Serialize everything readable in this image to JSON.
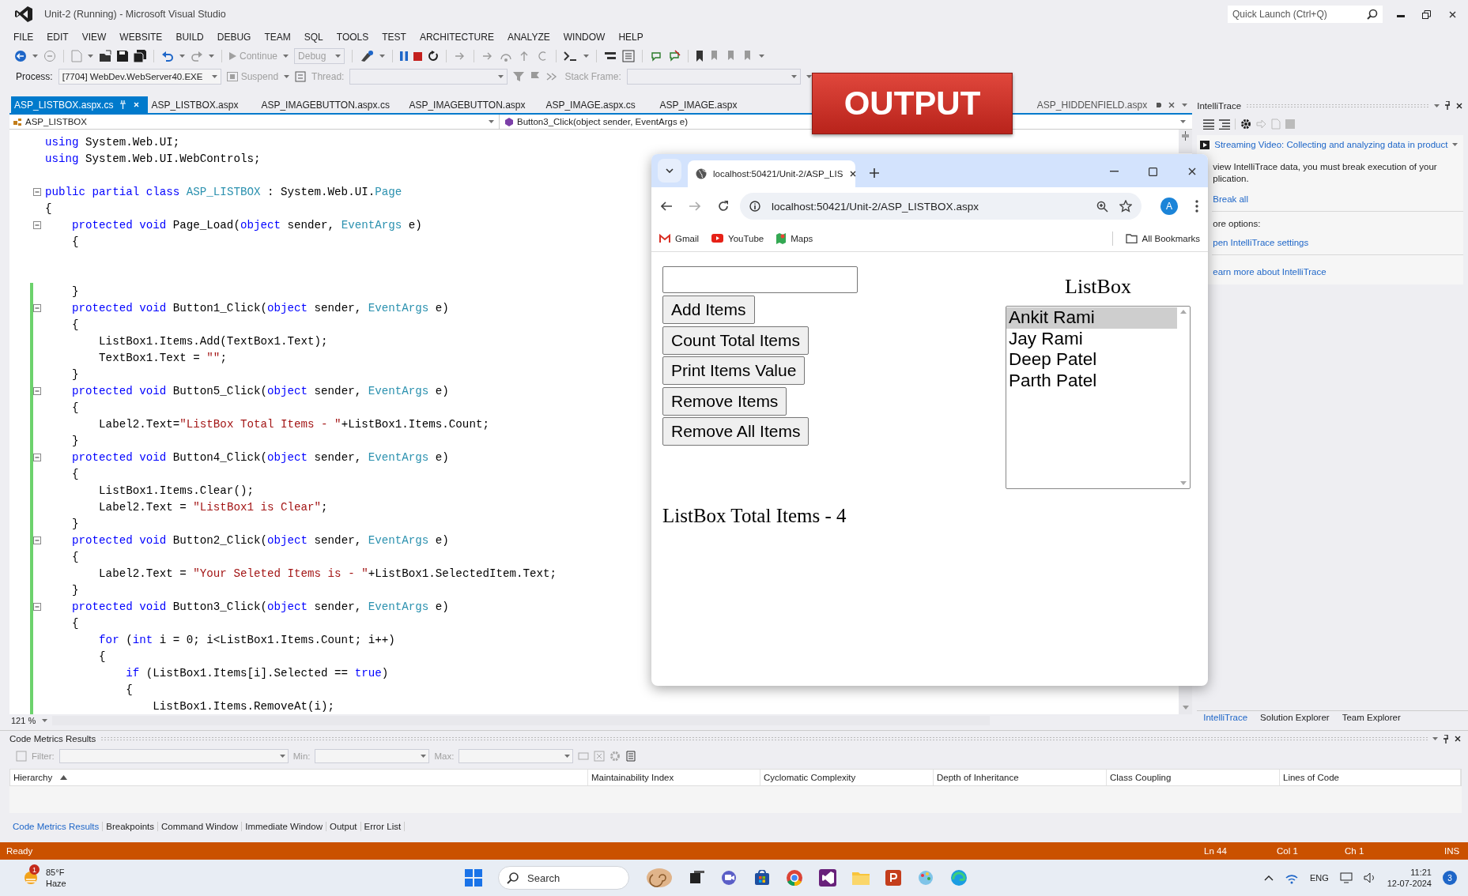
{
  "window": {
    "title": "Unit-2 (Running) - Microsoft Visual Studio",
    "quick_launch": {
      "placeholder": "Quick Launch (Ctrl+Q)"
    }
  },
  "menu": [
    "FILE",
    "EDIT",
    "VIEW",
    "WEBSITE",
    "BUILD",
    "DEBUG",
    "TEAM",
    "SQL",
    "TOOLS",
    "TEST",
    "ARCHITECTURE",
    "ANALYZE",
    "WINDOW",
    "HELP"
  ],
  "toolbar": {
    "continue": "Continue",
    "configuration": "Debug"
  },
  "debug_location": {
    "process_label": "Process:",
    "process": "[7704] WebDev.WebServer40.EXE",
    "suspend": "Suspend",
    "thread_label": "Thread:",
    "stack_frame_label": "Stack Frame:"
  },
  "doc_tabs": [
    {
      "label": "ASP_LISTBOX.aspx.cs",
      "selected": true
    },
    {
      "label": "ASP_LISTBOX.aspx",
      "selected": false
    },
    {
      "label": "ASP_IMAGEBUTTON.aspx.cs",
      "selected": false
    },
    {
      "label": "ASP_IMAGEBUTTON.aspx",
      "selected": false
    },
    {
      "label": "ASP_IMAGE.aspx.cs",
      "selected": false
    },
    {
      "label": "ASP_IMAGE.aspx",
      "selected": false
    }
  ],
  "overflow_tab": {
    "label": "ASP_HIDDENFIELD.aspx"
  },
  "nav_bar": {
    "type": "ASP_LISTBOX",
    "member": "Button3_Click(object sender, EventArgs e)"
  },
  "editor": {
    "zoom": "121 %",
    "lines": [
      {
        "kind": "code",
        "segs": [
          {
            "kind": "keyword",
            "text": "using"
          },
          {
            "kind": "plain",
            "text": " System.Web.UI;"
          }
        ]
      },
      {
        "kind": "code",
        "segs": [
          {
            "kind": "keyword",
            "text": "using"
          },
          {
            "kind": "plain",
            "text": " System.Web.UI.WebControls;"
          }
        ]
      },
      {
        "kind": "blank"
      },
      {
        "kind": "code",
        "fold": true,
        "segs": [
          {
            "kind": "keyword",
            "text": "public partial class "
          },
          {
            "kind": "type",
            "text": "ASP_LISTBOX"
          },
          {
            "kind": "plain",
            "text": " : System.Web.UI."
          },
          {
            "kind": "type",
            "text": "Page"
          }
        ]
      },
      {
        "kind": "code",
        "segs": [
          {
            "kind": "plain",
            "text": "{"
          }
        ]
      },
      {
        "kind": "code",
        "fold": true,
        "segs": [
          {
            "kind": "keyword",
            "text": "    protected void"
          },
          {
            "kind": "plain",
            "text": " Page_Load("
          },
          {
            "kind": "keyword",
            "text": "object"
          },
          {
            "kind": "plain",
            "text": " sender, "
          },
          {
            "kind": "type",
            "text": "EventArgs"
          },
          {
            "kind": "plain",
            "text": " e)"
          }
        ]
      },
      {
        "kind": "code",
        "segs": [
          {
            "kind": "plain",
            "text": "    {"
          }
        ]
      },
      {
        "kind": "blank"
      },
      {
        "kind": "blank"
      },
      {
        "kind": "code",
        "changed": true,
        "segs": [
          {
            "kind": "plain",
            "text": "    }"
          }
        ]
      },
      {
        "kind": "code",
        "changed": true,
        "fold": true,
        "segs": [
          {
            "kind": "keyword",
            "text": "    protected void"
          },
          {
            "kind": "plain",
            "text": " Button1_Click("
          },
          {
            "kind": "keyword",
            "text": "object"
          },
          {
            "kind": "plain",
            "text": " sender, "
          },
          {
            "kind": "type",
            "text": "EventArgs"
          },
          {
            "kind": "plain",
            "text": " e)"
          }
        ]
      },
      {
        "kind": "code",
        "changed": true,
        "segs": [
          {
            "kind": "plain",
            "text": "    {"
          }
        ]
      },
      {
        "kind": "code",
        "changed": true,
        "segs": [
          {
            "kind": "plain",
            "text": "        ListBox1.Items.Add(TextBox1.Text);"
          }
        ]
      },
      {
        "kind": "code",
        "changed": true,
        "segs": [
          {
            "kind": "plain",
            "text": "        TextBox1.Text = "
          },
          {
            "kind": "string",
            "text": "\"\""
          },
          {
            "kind": "plain",
            "text": ";"
          }
        ]
      },
      {
        "kind": "code",
        "changed": true,
        "segs": [
          {
            "kind": "plain",
            "text": "    }"
          }
        ]
      },
      {
        "kind": "code",
        "changed": true,
        "fold": true,
        "segs": [
          {
            "kind": "keyword",
            "text": "    protected void"
          },
          {
            "kind": "plain",
            "text": " Button5_Click("
          },
          {
            "kind": "keyword",
            "text": "object"
          },
          {
            "kind": "plain",
            "text": " sender, "
          },
          {
            "kind": "type",
            "text": "EventArgs"
          },
          {
            "kind": "plain",
            "text": " e)"
          }
        ]
      },
      {
        "kind": "code",
        "changed": true,
        "segs": [
          {
            "kind": "plain",
            "text": "    {"
          }
        ]
      },
      {
        "kind": "code",
        "changed": true,
        "segs": [
          {
            "kind": "plain",
            "text": "        Label2.Text="
          },
          {
            "kind": "string",
            "text": "\"ListBox Total Items - \""
          },
          {
            "kind": "plain",
            "text": "+ListBox1.Items.Count;"
          }
        ]
      },
      {
        "kind": "code",
        "changed": true,
        "segs": [
          {
            "kind": "plain",
            "text": "    }"
          }
        ]
      },
      {
        "kind": "code",
        "changed": true,
        "fold": true,
        "segs": [
          {
            "kind": "keyword",
            "text": "    protected void"
          },
          {
            "kind": "plain",
            "text": " Button4_Click("
          },
          {
            "kind": "keyword",
            "text": "object"
          },
          {
            "kind": "plain",
            "text": " sender, "
          },
          {
            "kind": "type",
            "text": "EventArgs"
          },
          {
            "kind": "plain",
            "text": " e)"
          }
        ]
      },
      {
        "kind": "code",
        "changed": true,
        "segs": [
          {
            "kind": "plain",
            "text": "    {"
          }
        ]
      },
      {
        "kind": "code",
        "changed": true,
        "segs": [
          {
            "kind": "plain",
            "text": "        ListBox1.Items.Clear();"
          }
        ]
      },
      {
        "kind": "code",
        "changed": true,
        "segs": [
          {
            "kind": "plain",
            "text": "        Label2.Text = "
          },
          {
            "kind": "string",
            "text": "\"ListBox1 is Clear\""
          },
          {
            "kind": "plain",
            "text": ";"
          }
        ]
      },
      {
        "kind": "code",
        "changed": true,
        "segs": [
          {
            "kind": "plain",
            "text": "    }"
          }
        ]
      },
      {
        "kind": "code",
        "changed": true,
        "fold": true,
        "segs": [
          {
            "kind": "keyword",
            "text": "    protected void"
          },
          {
            "kind": "plain",
            "text": " Button2_Click("
          },
          {
            "kind": "keyword",
            "text": "object"
          },
          {
            "kind": "plain",
            "text": " sender, "
          },
          {
            "kind": "type",
            "text": "EventArgs"
          },
          {
            "kind": "plain",
            "text": " e)"
          }
        ]
      },
      {
        "kind": "code",
        "changed": true,
        "segs": [
          {
            "kind": "plain",
            "text": "    {"
          }
        ]
      },
      {
        "kind": "code",
        "changed": true,
        "segs": [
          {
            "kind": "plain",
            "text": "        Label2.Text = "
          },
          {
            "kind": "string",
            "text": "\"Your Seleted Items is - \""
          },
          {
            "kind": "plain",
            "text": "+ListBox1.SelectedItem.Text;"
          }
        ]
      },
      {
        "kind": "code",
        "changed": true,
        "segs": [
          {
            "kind": "plain",
            "text": "    }"
          }
        ]
      },
      {
        "kind": "code",
        "changed": true,
        "fold": true,
        "segs": [
          {
            "kind": "keyword",
            "text": "    protected void"
          },
          {
            "kind": "plain",
            "text": " Button3_Click("
          },
          {
            "kind": "keyword",
            "text": "object"
          },
          {
            "kind": "plain",
            "text": " sender, "
          },
          {
            "kind": "type",
            "text": "EventArgs"
          },
          {
            "kind": "plain",
            "text": " e)"
          }
        ]
      },
      {
        "kind": "code",
        "changed": true,
        "segs": [
          {
            "kind": "plain",
            "text": "    {"
          }
        ]
      },
      {
        "kind": "code",
        "changed": true,
        "segs": [
          {
            "kind": "keyword",
            "text": "        for"
          },
          {
            "kind": "plain",
            "text": " ("
          },
          {
            "kind": "keyword",
            "text": "int"
          },
          {
            "kind": "plain",
            "text": " i = 0; i<ListBox1.Items.Count; i++)"
          }
        ]
      },
      {
        "kind": "code",
        "changed": true,
        "segs": [
          {
            "kind": "plain",
            "text": "        {"
          }
        ]
      },
      {
        "kind": "code",
        "changed": true,
        "segs": [
          {
            "kind": "keyword",
            "text": "            if"
          },
          {
            "kind": "plain",
            "text": " (ListBox1.Items[i].Selected == "
          },
          {
            "kind": "keyword",
            "text": "true"
          },
          {
            "kind": "plain",
            "text": ")"
          }
        ]
      },
      {
        "kind": "code",
        "changed": true,
        "segs": [
          {
            "kind": "plain",
            "text": "            {"
          }
        ]
      },
      {
        "kind": "code",
        "changed": true,
        "segs": [
          {
            "kind": "plain",
            "text": "                ListBox1.Items.RemoveAt(i);"
          }
        ]
      }
    ]
  },
  "output_banner": {
    "text": "OUTPUT"
  },
  "browser": {
    "tab_title": "localhost:50421/Unit-2/ASP_LIS",
    "url": "localhost:50421/Unit-2/ASP_LISTBOX.aspx",
    "profile": "A",
    "bookmarks": [
      {
        "label": "Gmail",
        "kind": "mail"
      },
      {
        "label": "YouTube",
        "kind": "video"
      },
      {
        "label": "Maps",
        "kind": "map"
      }
    ],
    "all_bookmarks": "All Bookmarks",
    "buttons": [
      "Add Items",
      "Count Total Items",
      "Print Items Value",
      "Remove Items",
      "Remove All Items"
    ],
    "listbox_title": "ListBox",
    "listbox_items": [
      {
        "label": "Ankit Rami",
        "selected": true
      },
      {
        "label": "Jay Rami",
        "selected": false
      },
      {
        "label": "Deep Patel",
        "selected": false
      },
      {
        "label": "Parth Patel",
        "selected": false
      }
    ],
    "result": "ListBox Total Items - 4"
  },
  "intellitrace": {
    "title": "IntelliTrace",
    "video_link": "Streaming Video: Collecting and analyzing data in product",
    "message": "view IntelliTrace data, you must break execution of your plication.",
    "break_all": "Break all",
    "more_options": "ore options:",
    "settings_link": "pen IntelliTrace settings",
    "learn_link": "earn more about IntelliTrace"
  },
  "panel_tabs": [
    {
      "label": "IntelliTrace",
      "selected": true
    },
    {
      "label": "Solution Explorer",
      "selected": false
    },
    {
      "label": "Team Explorer",
      "selected": false
    }
  ],
  "code_metrics": {
    "title": "Code Metrics Results",
    "filter_label": "Filter:",
    "min_label": "Min:",
    "max_label": "Max:",
    "columns": [
      {
        "label": "Hierarchy",
        "sorted": true
      },
      {
        "label": "Maintainability Index"
      },
      {
        "label": "Cyclomatic Complexity"
      },
      {
        "label": "Depth of Inheritance"
      },
      {
        "label": "Class Coupling"
      },
      {
        "label": "Lines of Code"
      }
    ]
  },
  "tool_tabs": [
    {
      "label": "Code Metrics Results",
      "selected": true
    },
    {
      "label": "Breakpoints",
      "selected": false
    },
    {
      "label": "Command Window",
      "selected": false
    },
    {
      "label": "Immediate Window",
      "selected": false
    },
    {
      "label": "Output",
      "selected": false
    },
    {
      "label": "Error List",
      "selected": false
    }
  ],
  "status_bar": {
    "message": "Ready",
    "line": "Ln 44",
    "column": "Col 1",
    "char": "Ch 1",
    "mode": "INS"
  },
  "taskbar": {
    "weather": {
      "temperature": "85°F",
      "condition": "Haze",
      "alert_count": "1"
    },
    "search": {
      "placeholder": "Search"
    },
    "language": "ENG",
    "time": "11:21",
    "date": "12-07-2024",
    "notification_count": "3"
  }
}
